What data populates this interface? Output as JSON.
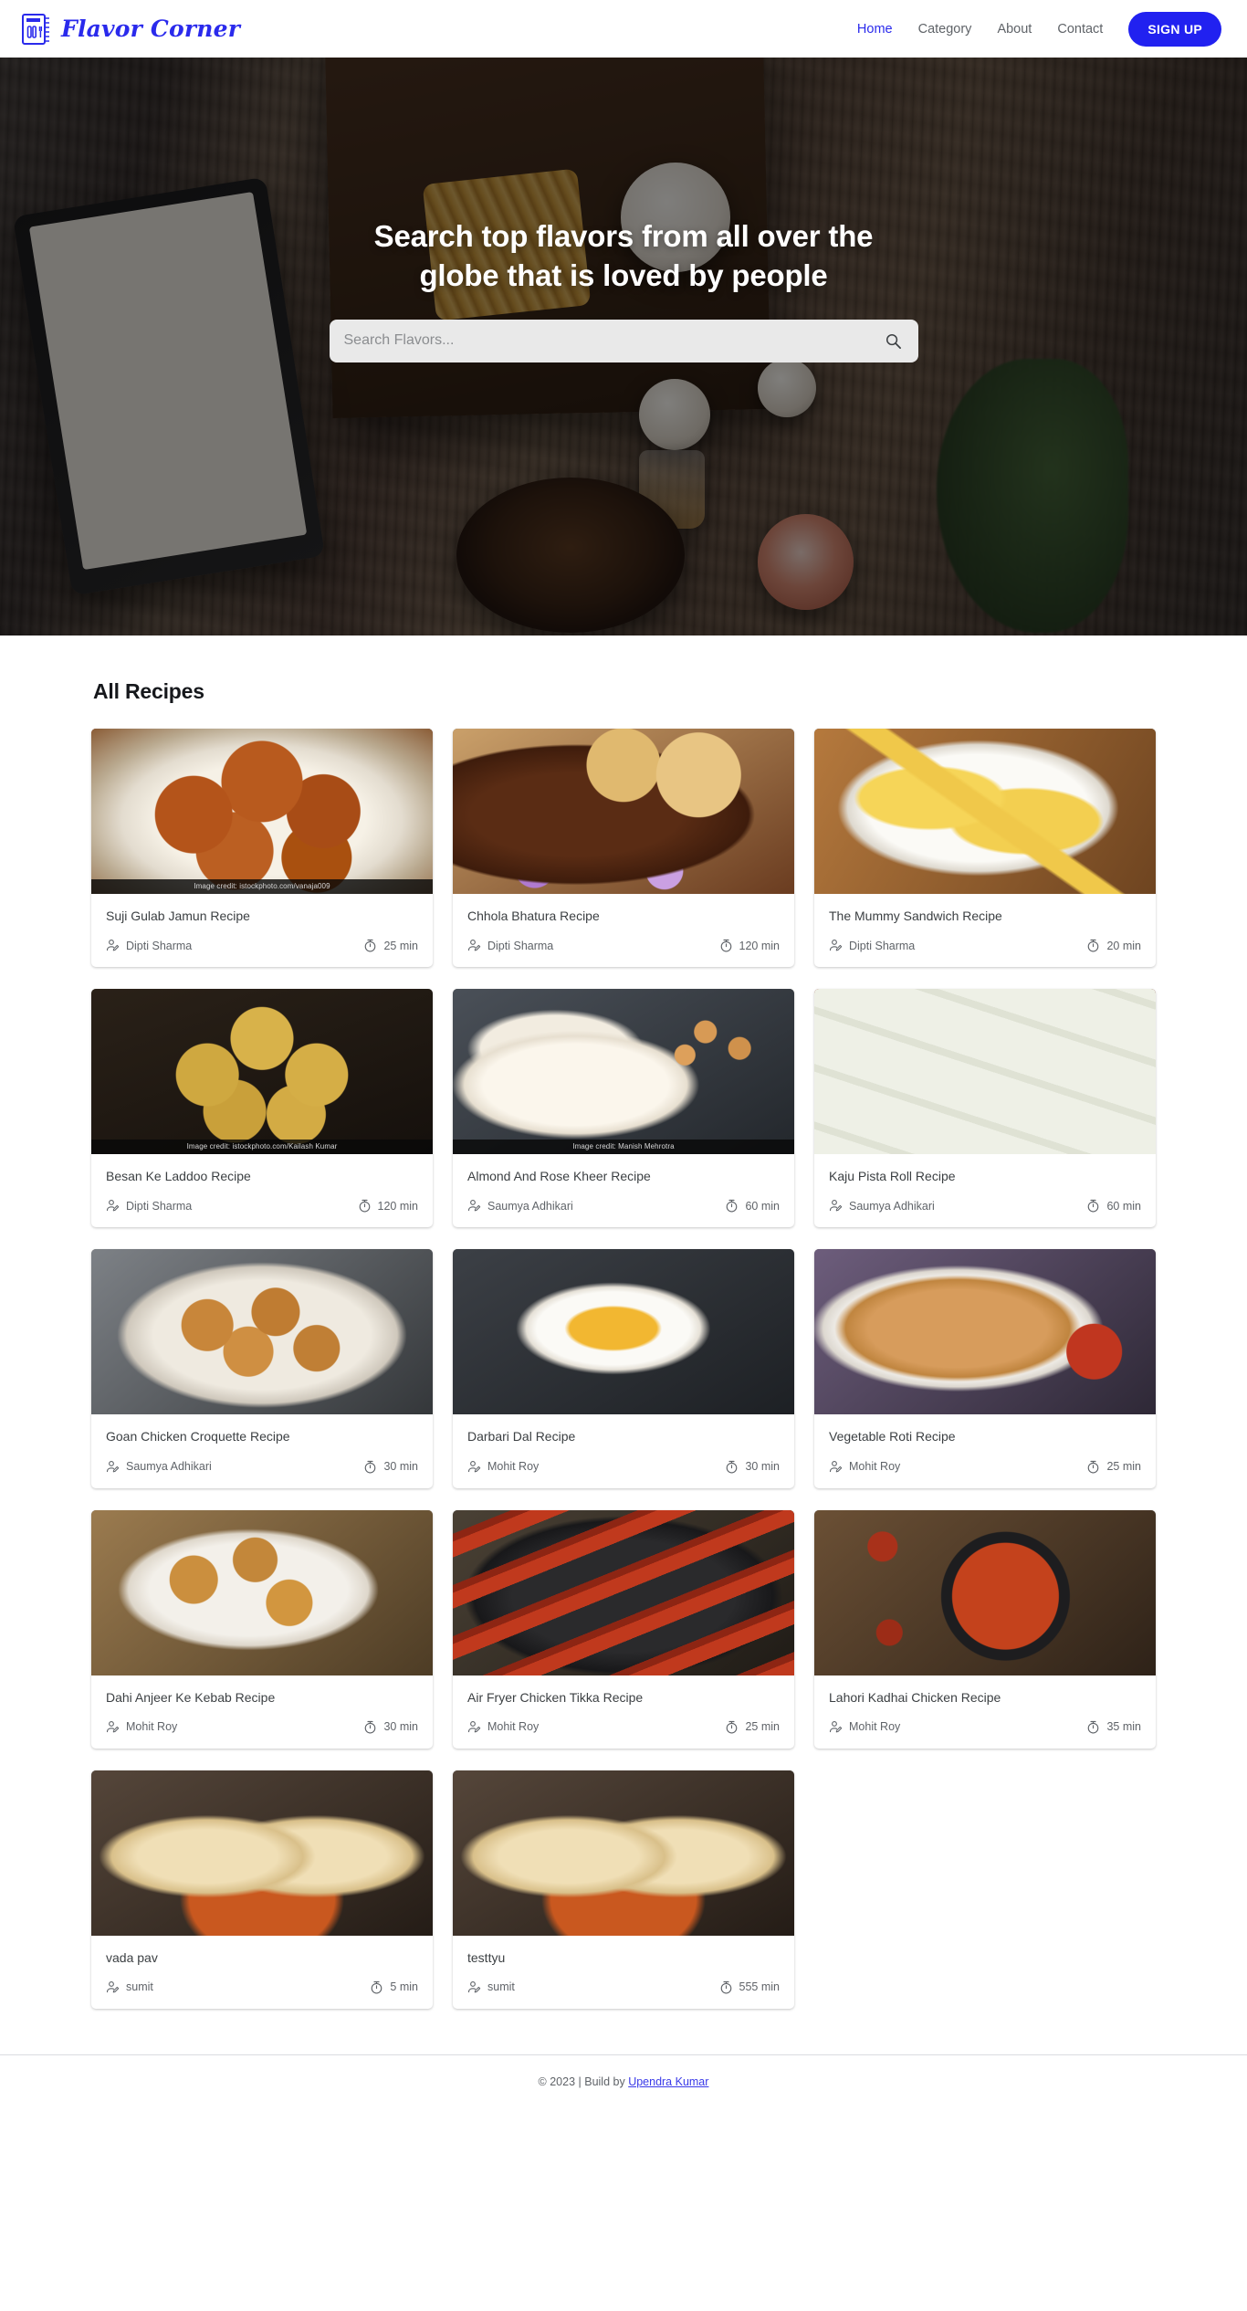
{
  "brand": {
    "name": "Flavor Corner",
    "icon": "recipe-book-icon",
    "color": "#2a2aec"
  },
  "nav": {
    "items": [
      {
        "label": "Home",
        "active": true
      },
      {
        "label": "Category",
        "active": false
      },
      {
        "label": "About",
        "active": false
      },
      {
        "label": "Contact",
        "active": false
      }
    ],
    "signup_label": "SIGN UP",
    "signup_color": "#2121f0"
  },
  "hero": {
    "title": "Search top flavors from all over the globe that is loved by people",
    "search_placeholder": "Search Flavors...",
    "search_value": "",
    "search_icon": "search-icon"
  },
  "recipes": {
    "section_title": "All Recipes",
    "author_icon": "person-edit-icon",
    "time_icon": "timer-icon",
    "items": [
      {
        "title": "Suji Gulab Jamun Recipe",
        "author": "Dipti Sharma",
        "time": "25 min",
        "credit": "Image credit: istockphoto.com/vanaja009"
      },
      {
        "title": "Chhola Bhatura Recipe",
        "author": "Dipti Sharma",
        "time": "120 min",
        "credit": ""
      },
      {
        "title": "The Mummy Sandwich Recipe",
        "author": "Dipti Sharma",
        "time": "20 min",
        "credit": ""
      },
      {
        "title": "Besan Ke Laddoo Recipe",
        "author": "Dipti Sharma",
        "time": "120 min",
        "credit": "Image credit: istockphoto.com/Kailash Kumar"
      },
      {
        "title": "Almond And Rose Kheer Recipe",
        "author": "Saumya Adhikari",
        "time": "60 min",
        "credit": "Image credit: Manish Mehrotra"
      },
      {
        "title": "Kaju Pista Roll Recipe",
        "author": "Saumya Adhikari",
        "time": "60 min",
        "credit": ""
      },
      {
        "title": "Goan Chicken Croquette Recipe",
        "author": "Saumya Adhikari",
        "time": "30 min",
        "credit": ""
      },
      {
        "title": "Darbari Dal Recipe",
        "author": "Mohit Roy",
        "time": "30 min",
        "credit": ""
      },
      {
        "title": "Vegetable Roti Recipe",
        "author": "Mohit Roy",
        "time": "25 min",
        "credit": ""
      },
      {
        "title": "Dahi Anjeer Ke Kebab Recipe",
        "author": "Mohit Roy",
        "time": "30 min",
        "credit": ""
      },
      {
        "title": "Air Fryer Chicken Tikka Recipe",
        "author": "Mohit Roy",
        "time": "25 min",
        "credit": ""
      },
      {
        "title": "Lahori Kadhai Chicken Recipe",
        "author": "Mohit Roy",
        "time": "35 min",
        "credit": ""
      },
      {
        "title": "vada pav",
        "author": "sumit",
        "time": "5 min",
        "credit": ""
      },
      {
        "title": "testtyu",
        "author": "sumit",
        "time": "555 min",
        "credit": ""
      }
    ]
  },
  "footer": {
    "prefix": "© 2023 | Build by ",
    "link": "Upendra Kumar"
  }
}
